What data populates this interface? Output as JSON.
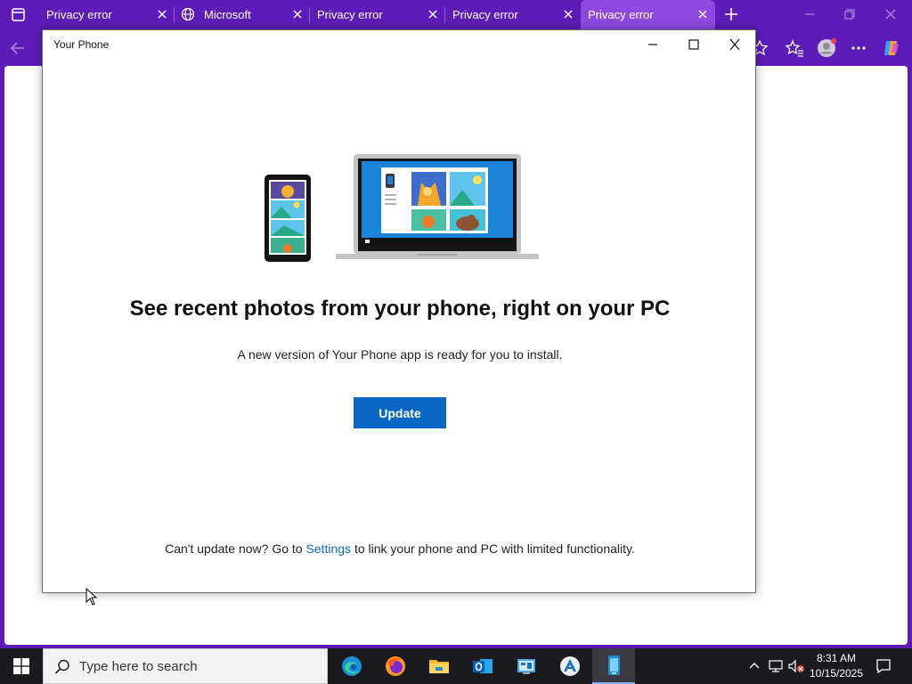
{
  "browser": {
    "tabs": [
      {
        "title": "Privacy error",
        "active": false
      },
      {
        "title": "Microsoft",
        "active": false
      },
      {
        "title": "Privacy error",
        "active": false
      },
      {
        "title": "Privacy error",
        "active": false
      },
      {
        "title": "Privacy error",
        "active": true
      }
    ],
    "accent": "#5d1bb8",
    "active_tab_color": "#8f49e0"
  },
  "app_window": {
    "title": "Your Phone",
    "headline": "See recent photos from your phone, right on your PC",
    "subtext": "A new version of Your Phone app is ready for you to install.",
    "update_label": "Update",
    "footer_prefix": "Can't update now? Go to ",
    "footer_link": "Settings",
    "footer_suffix": " to link your phone and PC with limited functionality.",
    "button_color": "#0a67c2"
  },
  "taskbar": {
    "search_placeholder": "Type here to search",
    "apps": [
      "edge-icon",
      "firefox-icon",
      "file-explorer-icon",
      "outlook-icon",
      "control-panel-icon",
      "app-store-icon",
      "your-phone-icon"
    ],
    "time": "8:31 AM",
    "date": "10/15/2025"
  }
}
